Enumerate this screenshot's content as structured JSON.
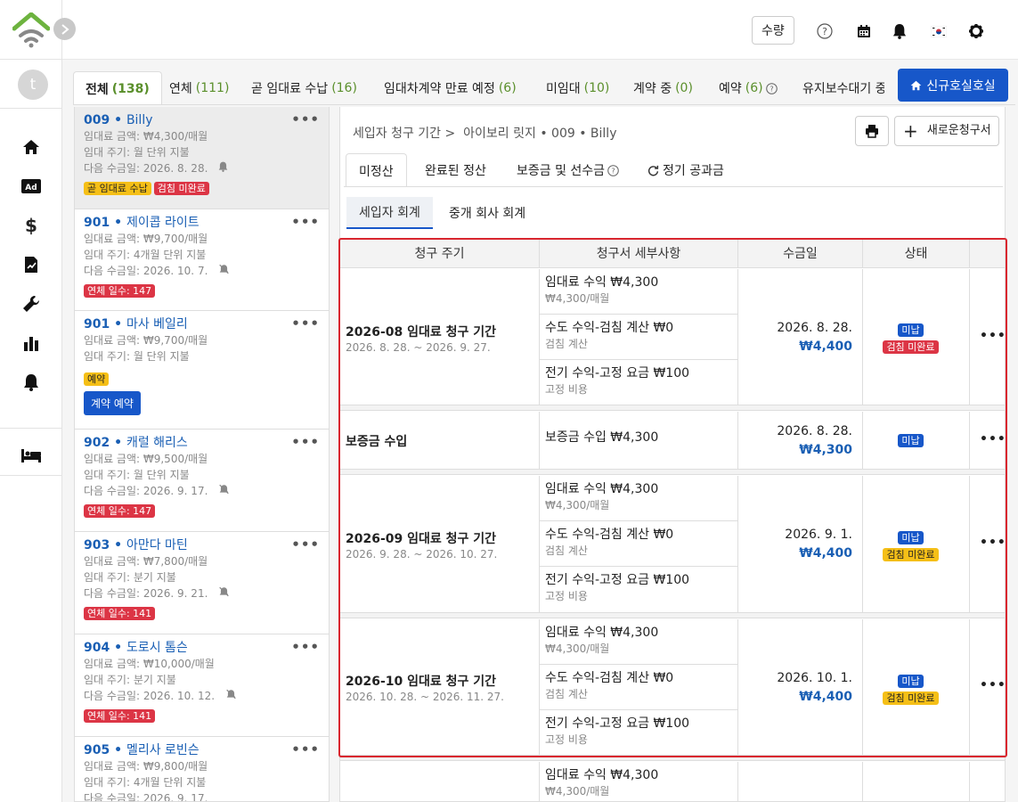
{
  "header": {
    "quantity_button": "수량"
  },
  "tabs": [
    {
      "label": "전체",
      "count": "(138)"
    },
    {
      "label": "연체",
      "count": "(111)"
    },
    {
      "label": "곧 임대료 수납",
      "count": "(16)"
    },
    {
      "label": "임대차계약 만료 예정",
      "count": "(6)"
    },
    {
      "label": "미임대",
      "count": "(10)"
    },
    {
      "label": "계약 중",
      "count": "(0)"
    },
    {
      "label": "예약",
      "count": "(6)"
    },
    {
      "label": "유지보수대기 중",
      "count": ""
    }
  ],
  "new_room_button": "신규호실호실",
  "tenants": [
    {
      "unit": "009",
      "name": "Billy",
      "rent": "임대료 금액: ₩4,300/매월",
      "cycle": "임대 주기: 월 단위 지불",
      "next": "다음 수금일:  2026. 8. 28.",
      "badges": [
        "곧 임대료 수납",
        "검침 미완료"
      ]
    },
    {
      "unit": "901",
      "name": "제이콥 라이트",
      "rent": "임대료 금액: ₩9,700/매월",
      "cycle": "임대 주기: 4개월 단위 지불",
      "next": "다음 수금일:  2026. 10. 7.",
      "badges": [
        "연체 일수: 147"
      ]
    },
    {
      "unit": "901",
      "name": "마사 베일리",
      "rent": "임대료 금액: ₩9,700/매월",
      "cycle": "임대 주기: 월 단위 지불",
      "badges": [
        "예약"
      ],
      "action": "계약 예약"
    },
    {
      "unit": "902",
      "name": "캐럴 해리스",
      "rent": "임대료 금액: ₩9,500/매월",
      "cycle": "임대 주기: 월 단위 지불",
      "next": "다음 수금일:  2026. 9. 17.",
      "badges": [
        "연체 일수: 147"
      ]
    },
    {
      "unit": "903",
      "name": "아만다 마틴",
      "rent": "임대료 금액: ₩7,800/매월",
      "cycle": "임대 주기: 분기 지불",
      "next": "다음 수금일:  2026. 9. 21.",
      "badges": [
        "연체 일수: 141"
      ]
    },
    {
      "unit": "904",
      "name": "도로시 톰슨",
      "rent": "임대료 금액: ₩10,000/매월",
      "cycle": "임대 주기: 분기 지불",
      "next": "다음 수금일:  2026. 10. 12.",
      "badges": [
        "연체 일수: 141"
      ]
    },
    {
      "unit": "905",
      "name": "멜리사 로빈슨",
      "rent": "임대료 금액: ₩9,800/매월",
      "cycle": "임대 주기: 4개월 단위 지불",
      "next": "다음 수금일:  2026. 9. 17."
    }
  ],
  "main": {
    "breadcrumb_root": "세입자 청구 기간 >",
    "breadcrumb_leaf": "아이보리 릿지 • 009 • Billy",
    "new_invoice": "새로운청구서",
    "tabs": [
      "미정산",
      "완료된 정산",
      "보증금 및 선수금",
      "정기 공과금"
    ],
    "subtabs": [
      "세입자 회계",
      "중개 회사 회계"
    ],
    "columns": [
      "청구 주기",
      "청구서 세부사항",
      "수금일",
      "상태"
    ],
    "rows": [
      {
        "title": "2026-08 임대료 청구 기간",
        "range": "2026. 8. 28. ~ 2026. 9. 27.",
        "details": [
          {
            "main": "임대료 수익  ₩4,300",
            "sub": "₩4,300/매월"
          },
          {
            "main": "수도 수익-검침 계산  ₩0",
            "sub": "검침 계산"
          },
          {
            "main": "전기 수익-고정 요금  ₩100",
            "sub": "고정 비용"
          }
        ],
        "date": "2026. 8. 28.",
        "amount": "₩4,400",
        "status": "미납",
        "meter": "검침 미완료"
      },
      {
        "title": "보증금 수입",
        "range": "",
        "details": [
          {
            "main": "보증금 수입  ₩4,300",
            "sub": ""
          }
        ],
        "date": "2026. 8. 28.",
        "amount": "₩4,300",
        "status": "미납",
        "meter": ""
      },
      {
        "title": "2026-09 임대료 청구 기간",
        "range": "2026. 9. 28. ~ 2026. 10. 27.",
        "details": [
          {
            "main": "임대료 수익  ₩4,300",
            "sub": "₩4,300/매월"
          },
          {
            "main": "수도 수익-검침 계산  ₩0",
            "sub": "검침 계산"
          },
          {
            "main": "전기 수익-고정 요금  ₩100",
            "sub": "고정 비용"
          }
        ],
        "date": "2026. 9. 1.",
        "amount": "₩4,400",
        "status": "미납",
        "meter": "검침 미완료"
      },
      {
        "title": "2026-10 임대료 청구 기간",
        "range": "2026. 10. 28. ~ 2026. 11. 27.",
        "details": [
          {
            "main": "임대료 수익  ₩4,300",
            "sub": "₩4,300/매월"
          },
          {
            "main": "수도 수익-검침 계산  ₩0",
            "sub": "검침 계산"
          },
          {
            "main": "전기 수익-고정 요금  ₩100",
            "sub": "고정 비용"
          }
        ],
        "date": "2026. 10. 1.",
        "amount": "₩4,400",
        "status": "미납",
        "meter": "검침 미완료"
      },
      {
        "title": "",
        "range": "",
        "details": [
          {
            "main": "임대료 수익  ₩4,300",
            "sub": "₩4,300/매월"
          }
        ],
        "date": "",
        "amount": "",
        "status": "",
        "meter": ""
      }
    ]
  },
  "colors": {
    "primary": "#1757c9",
    "red": "#dc3545",
    "yellow": "#f5bf17",
    "green_count": "#5a8f2b",
    "highlight": "#d9262e"
  }
}
